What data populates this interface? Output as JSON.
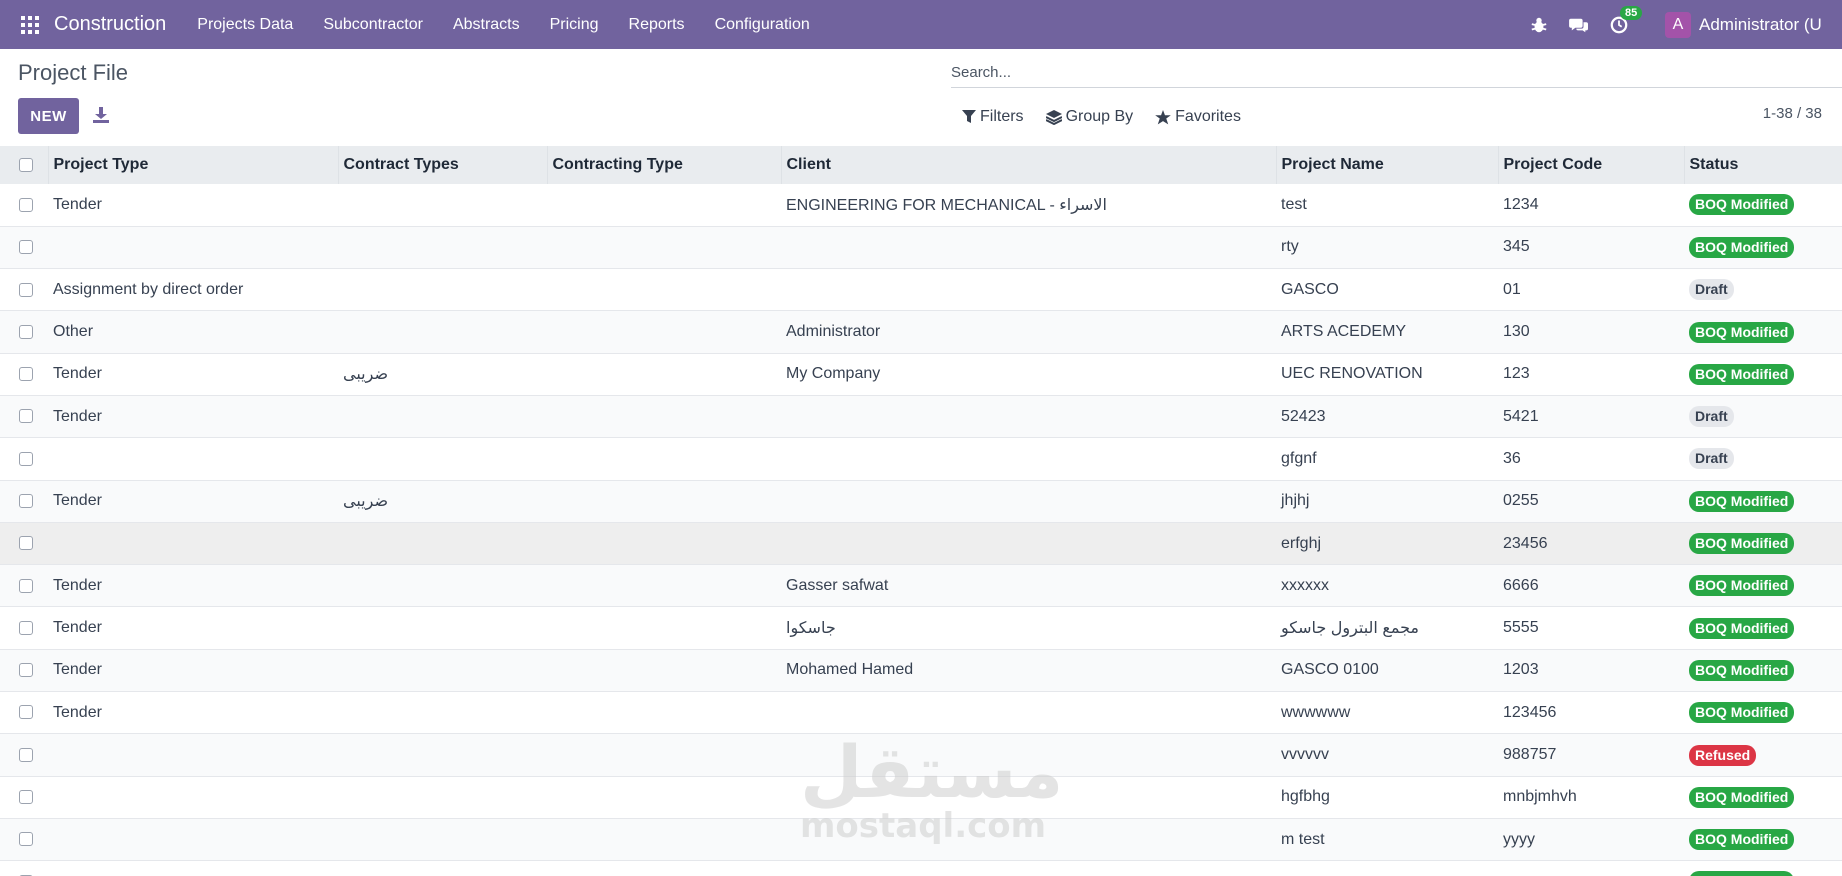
{
  "navbar": {
    "brand": "Construction",
    "menu": [
      "Projects Data",
      "Subcontractor",
      "Abstracts",
      "Pricing",
      "Reports",
      "Configuration"
    ],
    "activity_count": "85",
    "avatar_letter": "A",
    "user_name": "Administrator (U"
  },
  "control_panel": {
    "title": "Project File",
    "new_label": "NEW",
    "search_placeholder": "Search...",
    "filters_label": "Filters",
    "group_by_label": "Group By",
    "favorites_label": "Favorites",
    "pager": "1-38 / 38"
  },
  "table": {
    "columns": [
      "Project Type",
      "Contract Types",
      "Contracting Type",
      "Client",
      "Project Name",
      "Project Code",
      "Status"
    ],
    "rows": [
      {
        "project_type": "Tender",
        "contract_types": "",
        "contracting_type": "",
        "client": "ENGINEERING FOR MECHANICAL - الاسراء",
        "project_name": "test",
        "project_code": "1234",
        "status": "BOQ Modified"
      },
      {
        "project_type": "",
        "contract_types": "",
        "contracting_type": "",
        "client": "",
        "project_name": "rty",
        "project_code": "345",
        "status": "BOQ Modified"
      },
      {
        "project_type": "Assignment by direct order",
        "contract_types": "",
        "contracting_type": "",
        "client": "",
        "project_name": "GASCO",
        "project_code": "01",
        "status": "Draft"
      },
      {
        "project_type": "Other",
        "contract_types": "",
        "contracting_type": "",
        "client": "Administrator",
        "project_name": "ARTS ACEDEMY",
        "project_code": "130",
        "status": "BOQ Modified"
      },
      {
        "project_type": "Tender",
        "contract_types": "ضريبى",
        "contracting_type": "",
        "client": "My Company",
        "project_name": "UEC RENOVATION",
        "project_code": "123",
        "status": "BOQ Modified"
      },
      {
        "project_type": "Tender",
        "contract_types": "",
        "contracting_type": "",
        "client": "",
        "project_name": "52423",
        "project_code": "5421",
        "status": "Draft"
      },
      {
        "project_type": "",
        "contract_types": "",
        "contracting_type": "",
        "client": "",
        "project_name": "gfgnf",
        "project_code": "36",
        "status": "Draft"
      },
      {
        "project_type": "Tender",
        "contract_types": "ضريبى",
        "contracting_type": "",
        "client": "",
        "project_name": "jhjhj",
        "project_code": "0255",
        "status": "BOQ Modified"
      },
      {
        "project_type": "",
        "contract_types": "",
        "contracting_type": "",
        "client": "",
        "project_name": "erfghj",
        "project_code": "23456",
        "status": "BOQ Modified"
      },
      {
        "project_type": "Tender",
        "contract_types": "",
        "contracting_type": "",
        "client": "Gasser safwat",
        "project_name": "xxxxxx",
        "project_code": "6666",
        "status": "BOQ Modified"
      },
      {
        "project_type": "Tender",
        "contract_types": "",
        "contracting_type": "",
        "client": "جاسكوا",
        "project_name": "مجمع البترول جاسكو",
        "project_code": "5555",
        "status": "BOQ Modified"
      },
      {
        "project_type": "Tender",
        "contract_types": "",
        "contracting_type": "",
        "client": "Mohamed Hamed",
        "project_name": "GASCO 0100",
        "project_code": "1203",
        "status": "BOQ Modified"
      },
      {
        "project_type": "Tender",
        "contract_types": "",
        "contracting_type": "",
        "client": "",
        "project_name": "wwwwww",
        "project_code": "123456",
        "status": "BOQ Modified"
      },
      {
        "project_type": "",
        "contract_types": "",
        "contracting_type": "",
        "client": "",
        "project_name": "vvvvvv",
        "project_code": "988757",
        "status": "Refused"
      },
      {
        "project_type": "",
        "contract_types": "",
        "contracting_type": "",
        "client": "",
        "project_name": "hgfbhg",
        "project_code": "mnbjmhvh",
        "status": "BOQ Modified"
      },
      {
        "project_type": "",
        "contract_types": "",
        "contracting_type": "",
        "client": "",
        "project_name": "m test",
        "project_code": "yyyy",
        "status": "BOQ Modified"
      },
      {
        "project_type": "",
        "contract_types": "",
        "contracting_type": "",
        "client": "",
        "project_name": "",
        "project_code": "",
        "status": "BOQ Modified"
      }
    ]
  },
  "watermark": {
    "arabic": "مستقل",
    "latin": "mostaql.com"
  },
  "colors": {
    "navbar": "#71639e",
    "primary_button": "#71639e",
    "status_boq": "#28a745",
    "status_draft": "#e5e7eb",
    "status_refused": "#dc3545",
    "activity_badge": "#28a745",
    "avatar": "#a353a9"
  },
  "icons": {
    "apps": "apps-grid-icon",
    "debug": "bug-icon",
    "messages": "chat-icon",
    "activity": "clock-icon",
    "download": "download-icon",
    "filters": "filter-icon",
    "group_by": "layers-icon",
    "favorites": "star-icon"
  }
}
